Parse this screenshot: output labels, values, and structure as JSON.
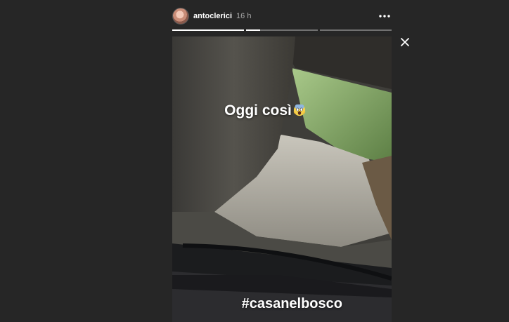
{
  "header": {
    "username": "antoclerici",
    "timestamp": "16 h",
    "more_icon": "more-horizontal-icon",
    "avatar_icon": "profile-avatar"
  },
  "progress": {
    "segments": [
      1.0,
      0.2,
      0.0
    ]
  },
  "close": {
    "icon": "close-icon"
  },
  "story": {
    "caption_top": "Oggi così",
    "caption_top_emoji": "screaming-face-emoji",
    "caption_bottom": "#casanelbosco"
  },
  "colors": {
    "background": "#262626",
    "text": "#ffffff",
    "muted": "#a8a8a8"
  }
}
